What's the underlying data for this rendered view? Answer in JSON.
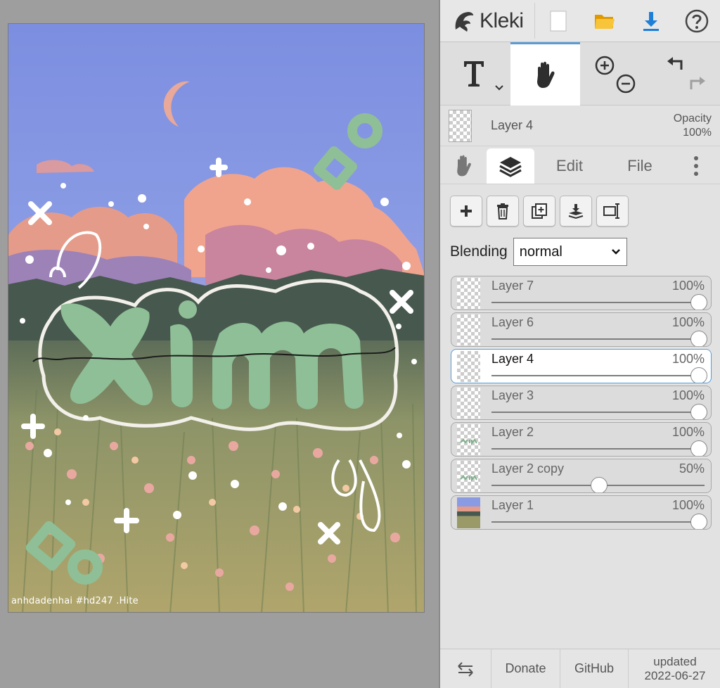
{
  "app": {
    "name": "Kleki"
  },
  "canvas": {
    "watermark": "anhdadenhai #hd247 .Hite"
  },
  "current_layer": {
    "name": "Layer 4",
    "opacity_label": "Opacity",
    "opacity_value": "100%"
  },
  "tabs": [
    {
      "label": "Edit"
    },
    {
      "label": "File"
    }
  ],
  "blending": {
    "label": "Blending",
    "value": "normal"
  },
  "layers": [
    {
      "name": "Layer 7",
      "opacity": "100%",
      "value": 1.0,
      "selected": false,
      "thumb": "empty"
    },
    {
      "name": "Layer 6",
      "opacity": "100%",
      "value": 1.0,
      "selected": false,
      "thumb": "empty"
    },
    {
      "name": "Layer 4",
      "opacity": "100%",
      "value": 1.0,
      "selected": true,
      "thumb": "empty"
    },
    {
      "name": "Layer 3",
      "opacity": "100%",
      "value": 1.0,
      "selected": false,
      "thumb": "empty"
    },
    {
      "name": "Layer 2",
      "opacity": "100%",
      "value": 1.0,
      "selected": false,
      "thumb": "green-text"
    },
    {
      "name": "Layer 2 copy",
      "opacity": "50%",
      "value": 0.5,
      "selected": false,
      "thumb": "green-text"
    },
    {
      "name": "Layer 1",
      "opacity": "100%",
      "value": 1.0,
      "selected": false,
      "thumb": "landscape"
    }
  ],
  "footer": {
    "donate": "Donate",
    "github": "GitHub",
    "updated_label": "updated",
    "updated_date": "2022-06-27"
  },
  "colors": {
    "accent": "#5b9bd5",
    "download": "#1e7fd8",
    "folder": "#f4b400",
    "sage": "#8fbf96"
  }
}
